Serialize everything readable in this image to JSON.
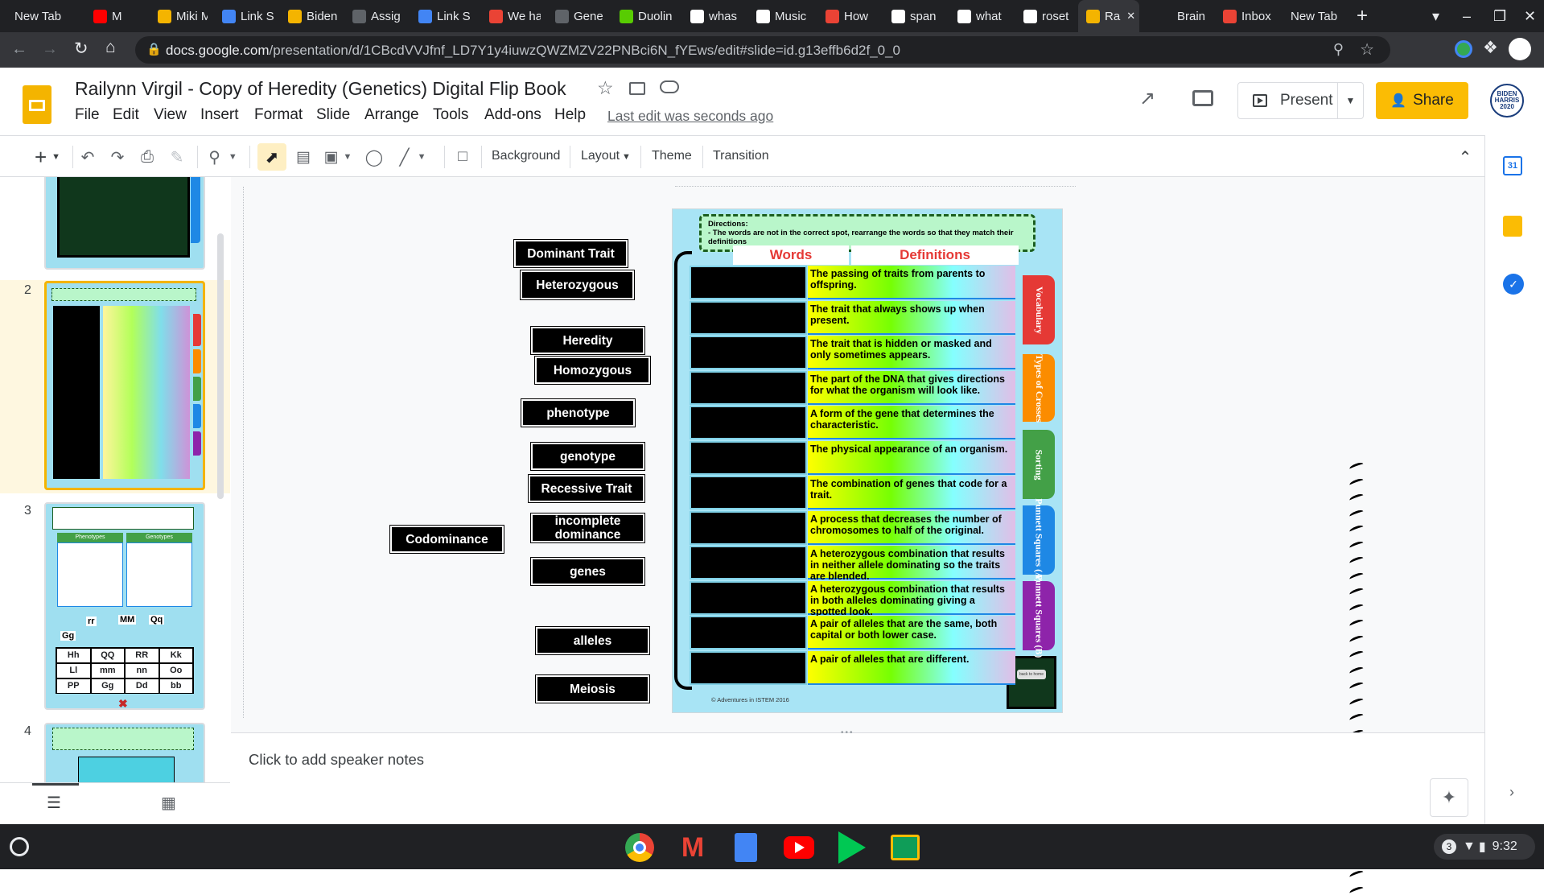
{
  "browser": {
    "tabs": [
      {
        "title": "New Tab",
        "icon": "none"
      },
      {
        "title": "M",
        "icon": "youtube-icon"
      },
      {
        "title": "Miki M",
        "icon": "slides-icon"
      },
      {
        "title": "Link S",
        "icon": "docs-icon"
      },
      {
        "title": "Biden",
        "icon": "slides-icon"
      },
      {
        "title": "Assig",
        "icon": "classroom-icon"
      },
      {
        "title": "Link S",
        "icon": "docs-icon"
      },
      {
        "title": "We ha",
        "icon": "gmail-icon"
      },
      {
        "title": "Gene",
        "icon": "classroom-icon"
      },
      {
        "title": "Duolin",
        "icon": "duolingo-icon"
      },
      {
        "title": "whas",
        "icon": "google-icon"
      },
      {
        "title": "Music",
        "icon": "music-icon"
      },
      {
        "title": "How",
        "icon": "quizlet-icon"
      },
      {
        "title": "span",
        "icon": "google-icon"
      },
      {
        "title": "what",
        "icon": "google-icon"
      },
      {
        "title": "roset",
        "icon": "google-icon"
      },
      {
        "title": "Ra",
        "icon": "slides-icon",
        "active": true
      },
      {
        "title": "Brain",
        "icon": "brainly-icon"
      },
      {
        "title": "Inbox",
        "icon": "gmail-icon"
      },
      {
        "title": "New Tab",
        "icon": "none"
      }
    ],
    "url_domain": "docs.google.com",
    "url_path": "/presentation/d/1CBcdVVJfnf_LD7Y1y4iuwzQWZMZV22PNBci6N_fYEws/edit#slide=id.g13effb6d2f_0_0"
  },
  "docs": {
    "title": "Railynn Virgil - Copy of Heredity (Genetics) Digital Flip Book",
    "menu": [
      "File",
      "Edit",
      "View",
      "Insert",
      "Format",
      "Slide",
      "Arrange",
      "Tools",
      "Add-ons",
      "Help"
    ],
    "last_edit": "Last edit was seconds ago",
    "present_label": "Present",
    "share_label": "Share",
    "avatar_text": "BIDEN HARRIS 2020"
  },
  "toolbar": {
    "background": "Background",
    "layout": "Layout",
    "theme": "Theme",
    "transition": "Transition"
  },
  "filmstrip": {
    "slide_numbers": [
      "2",
      "3",
      "4"
    ],
    "slide3_cells": [
      "Hh",
      "QQ",
      "RR",
      "Kk",
      "Ll",
      "mm",
      "nn",
      "Oo",
      "PP",
      "Gg",
      "Dd",
      "bb"
    ],
    "slide3_headers": [
      "Phenotypes",
      "Genotypes"
    ],
    "slide3_labels": [
      "rr",
      "MM",
      "Qq",
      "Gg"
    ]
  },
  "slide": {
    "directions_title": "Directions:",
    "directions_text": "- The words are not in the correct spot, rearrange the words so that they match their definitions",
    "header_words": "Words",
    "header_definitions": "Definitions",
    "definitions": [
      "The passing of traits from parents to offspring.",
      "The trait that always shows up when present.",
      "The trait that is hidden or masked and only sometimes appears.",
      "The part of the DNA that gives directions for what the organism will look like.",
      "A form of the gene that determines the characteristic.",
      "The physical appearance of an organism.",
      "The combination of genes that code for a trait.",
      "A process that decreases the number of chromosomes to half of the original.",
      "A heterozygous combination that results in neither allele dominating so the traits are blended.",
      "A heterozygous combination that results in both alleles dominating giving a spotted look.",
      "A pair of alleles that are the same, both capital or both lower case.",
      "A pair of alleles that are different."
    ],
    "side_tabs": [
      "Vocabulary",
      "Types of Crosses",
      "Sorting",
      "Punnett Squares (A)",
      "Punnett Squares (B)"
    ],
    "footer": "Adventures in ISTEM 2016",
    "back_button": "back to home"
  },
  "word_tiles": [
    "Dominant Trait",
    "Heterozygous",
    "Heredity",
    "Homozygous",
    "phenotype",
    "genotype",
    "Recessive Trait",
    "incomplete dominance",
    "Codominance",
    "genes",
    "alleles",
    "Meiosis"
  ],
  "notes": {
    "placeholder": "Click to add speaker notes"
  },
  "shelf": {
    "time": "9:32",
    "badge": "3"
  },
  "colors": {
    "slides_yellow": "#f4b400",
    "share_yellow": "#fbbc04",
    "slide_bg": "#a8e4f5"
  }
}
